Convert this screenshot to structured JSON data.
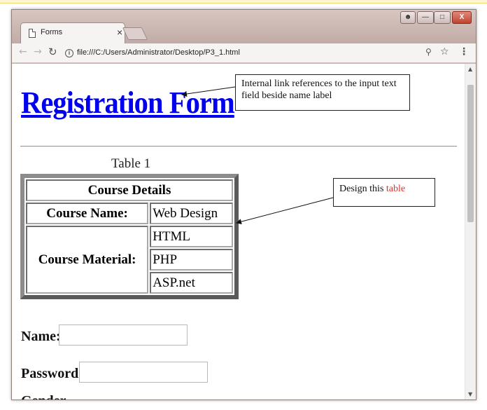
{
  "browser": {
    "tab_title": "Forms",
    "tab_close": "×",
    "url": "file:///C:/Users/Administrator/Desktop/P3_1.html"
  },
  "page": {
    "heading": "Registration Form",
    "table_caption": "Table 1",
    "table": {
      "header": "Course Details",
      "course_name_label": "Course Name:",
      "course_name_value": "Web Design",
      "course_material_label": "Course Material:",
      "materials": [
        "HTML",
        "PHP",
        "ASP.net"
      ]
    },
    "form": {
      "name_label": "Name:",
      "name_value": "",
      "password_label": "Password:",
      "password_value": "",
      "gender_label_partial": "Gender"
    }
  },
  "annotations": {
    "link_note": "Internal link references to the input text field beside name label",
    "table_note_prefix": "Design this ",
    "table_note_accent": "table",
    "accent_color": "#e03030"
  },
  "colors": {
    "link": "#0000ee",
    "table_border": "#5a5a5a"
  }
}
